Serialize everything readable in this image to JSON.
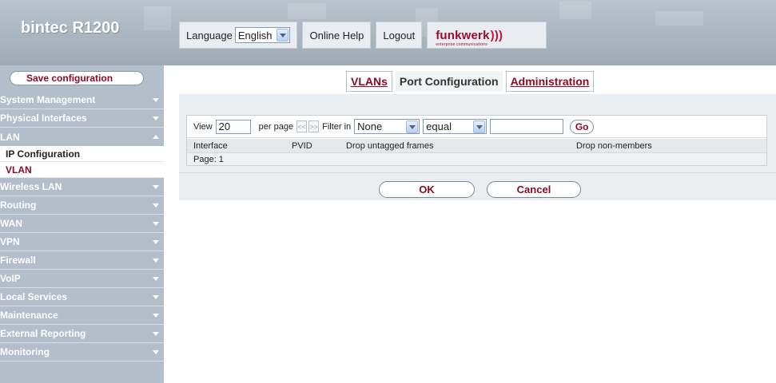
{
  "header": {
    "brand": "bintec R1200",
    "language_label": "Language",
    "language_value": "English",
    "online_help": "Online Help",
    "logout": "Logout",
    "logo_text": "funkwerk",
    "logo_subtext": "enterprise communications",
    "logo_waves": ")))"
  },
  "sidebar": {
    "save_label": "Save configuration",
    "items": [
      {
        "label": "System Management"
      },
      {
        "label": "Physical Interfaces"
      },
      {
        "label": "LAN"
      },
      {
        "label": "Wireless LAN"
      },
      {
        "label": "Routing"
      },
      {
        "label": "WAN"
      },
      {
        "label": "VPN"
      },
      {
        "label": "Firewall"
      },
      {
        "label": "VoIP"
      },
      {
        "label": "Local Services"
      },
      {
        "label": "Maintenance"
      },
      {
        "label": "External Reporting"
      },
      {
        "label": "Monitoring"
      }
    ],
    "lan_sub": [
      {
        "label": "IP Configuration"
      },
      {
        "label": "VLAN"
      }
    ]
  },
  "tabs": [
    {
      "label": "VLANs"
    },
    {
      "label": "Port Configuration"
    },
    {
      "label": "Administration"
    }
  ],
  "filter": {
    "view_label": "View",
    "view_value": "20",
    "per_page_label": "per page",
    "prev_glyph": "<<",
    "next_glyph": ">>",
    "filter_in_label": "Filter in",
    "filter_field": "None",
    "filter_op": "equal",
    "filter_value": "",
    "go_label": "Go"
  },
  "table": {
    "columns": [
      "Interface",
      "PVID",
      "Drop untagged frames",
      "Drop non-members"
    ],
    "page_label": "Page: 1"
  },
  "actions": {
    "ok": "OK",
    "cancel": "Cancel"
  },
  "colors": {
    "accent": "#8c0a24",
    "sidebar_bg": "#b2bec9",
    "header_bg": "#a9b5bf"
  }
}
